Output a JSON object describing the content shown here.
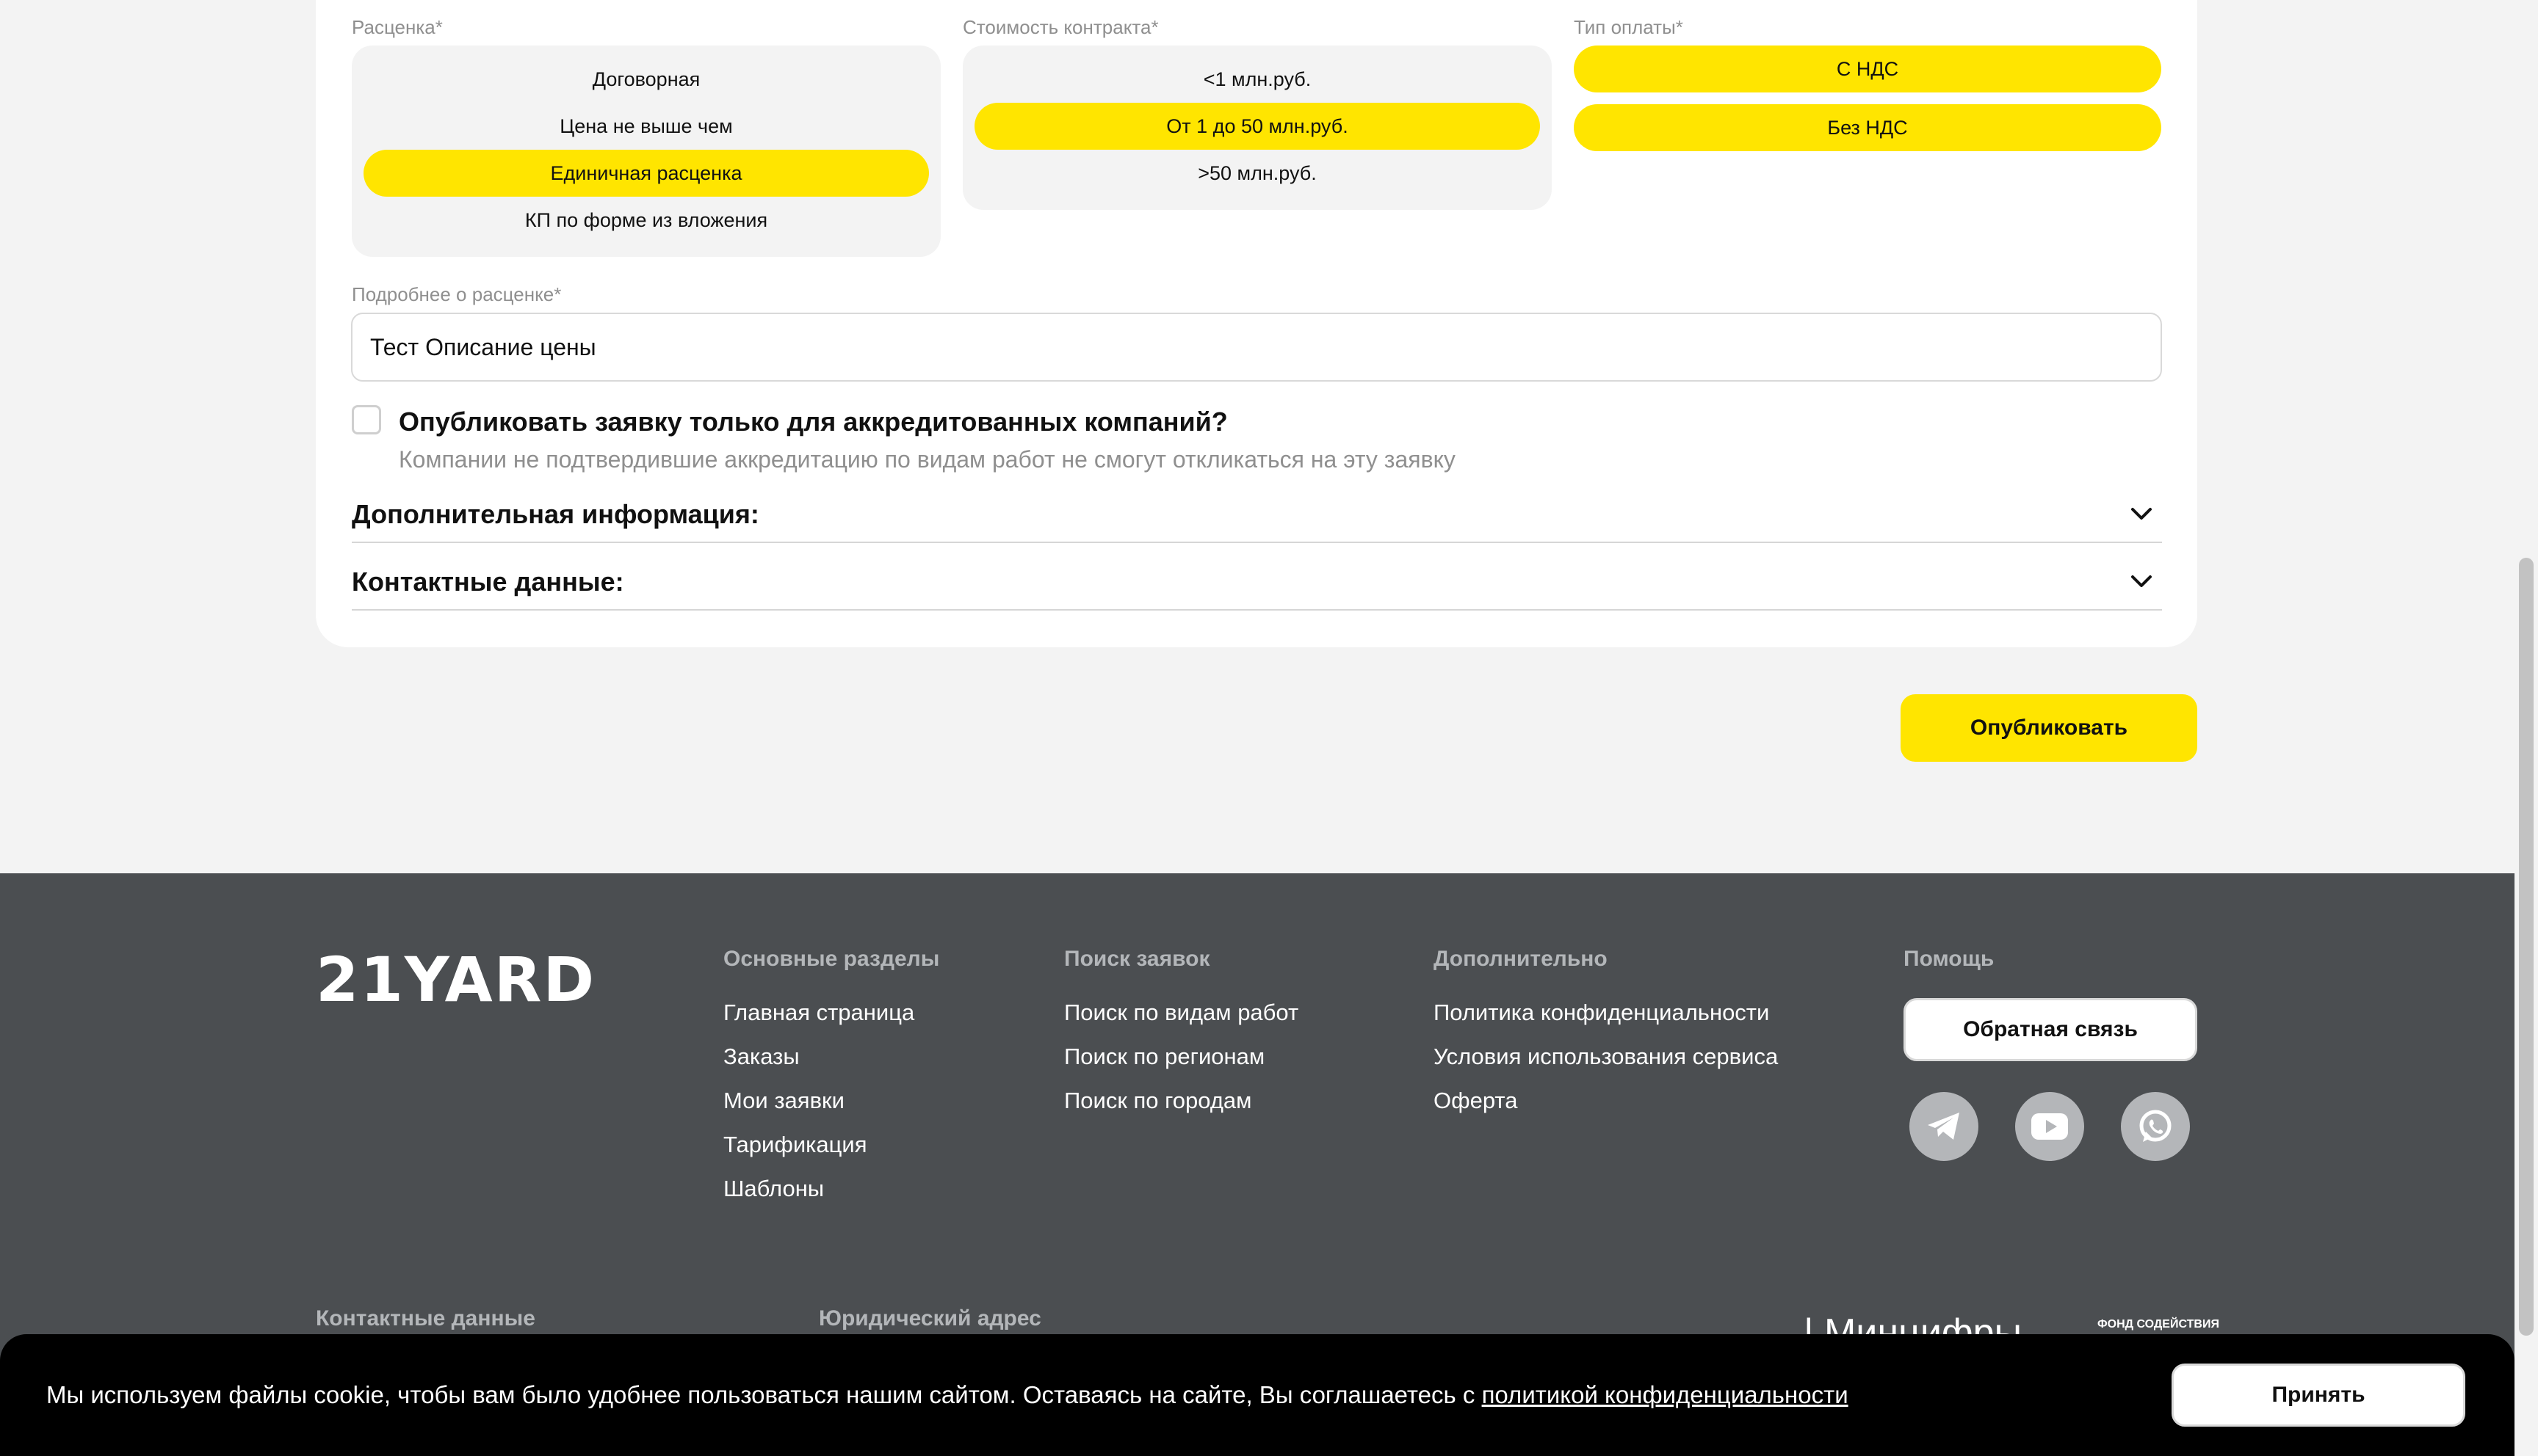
{
  "form": {
    "pricing": {
      "label": "Расценка*",
      "options": [
        "Договорная",
        "Цена не выше чем",
        "Единичная расценка",
        "КП по форме из вложения"
      ],
      "selected": "Единичная расценка"
    },
    "contract_value": {
      "label": "Стоимость контракта*",
      "options": [
        "<1 млн.руб.",
        "От 1 до 50 млн.руб.",
        ">50 млн.руб."
      ],
      "selected": "От 1 до 50 млн.руб."
    },
    "payment_type": {
      "label": "Тип оплаты*",
      "options": [
        "С НДС",
        "Без НДС"
      ],
      "selected": [
        "С НДС",
        "Без НДС"
      ]
    },
    "price_details": {
      "label": "Подробнее о расценке*",
      "value": "Тест Описание цены"
    },
    "accredited_only": {
      "checked": false,
      "title": "Опубликовать заявку только для аккредитованных компаний?",
      "subtitle": "Компании не подтвердившие аккредитацию по видам работ не смогут откликаться на эту заявку"
    },
    "sections": [
      "Дополнительная информация:",
      "Контактные данные:"
    ],
    "publish_label": "Опубликовать"
  },
  "footer": {
    "logo": "21YARD",
    "columns": [
      {
        "title": "Основные разделы",
        "links": [
          "Главная страница",
          "Заказы",
          "Мои заявки",
          "Тарификация",
          "Шаблоны"
        ]
      },
      {
        "title": "Поиск заявок",
        "links": [
          "Поиск по видам работ",
          "Поиск по регионам",
          "Поиск по городам"
        ]
      },
      {
        "title": "Дополнительно",
        "links": [
          "Политика конфиденциальности",
          "Условия использования сервиса",
          "Оферта"
        ]
      }
    ],
    "help": {
      "title": "Помощь",
      "feedback_label": "Обратная связь",
      "socials": [
        "telegram-icon",
        "youtube-icon",
        "whatsapp-icon"
      ]
    },
    "bottom": {
      "contacts_title": "Контактные данные",
      "address_title": "Юридический адрес",
      "partner": "| Минцифры",
      "partner_small": "ФОНД СОДЕЙСТВИЯ"
    }
  },
  "cookie": {
    "text": "Мы используем файлы cookie, чтобы вам было удобнее пользоваться нашим сайтом. Оставаясь на сайте, Вы соглашаетесь с ",
    "link": "политикой конфиденциальности",
    "accept_label": "Принять"
  },
  "colors": {
    "accent": "#ffe500",
    "footer_bg": "#4b4e51",
    "page_bg": "#f3f3f3"
  }
}
